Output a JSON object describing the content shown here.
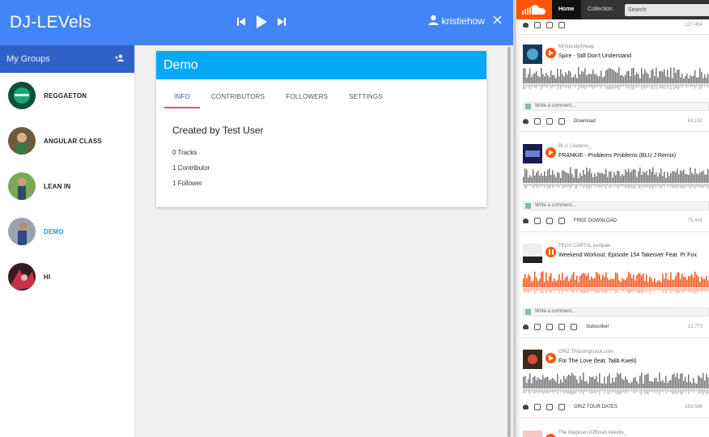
{
  "app": {
    "title": "DJ-LEVels",
    "user_name": "kristiehow"
  },
  "sidebar": {
    "heading": "My Groups",
    "groups": [
      {
        "label": "REGGAETON"
      },
      {
        "label": "ANGULAR CLASS"
      },
      {
        "label": "LEAN IN"
      },
      {
        "label": "DEMO"
      },
      {
        "label": "HI"
      }
    ]
  },
  "group": {
    "name": "Demo",
    "tabs": [
      "INFO",
      "CONTRIBUTORS",
      "FOLLOWERS",
      "SETTINGS"
    ],
    "active_tab": "INFO",
    "created_by": "Created by Test User",
    "tracks": "0 Tracks",
    "contributors": "1 Contributor",
    "followers": "1 Follower"
  },
  "soundcloud": {
    "nav": {
      "home": "Home",
      "collection": "Collection",
      "search_placeholder": "Search"
    },
    "comment_placeholder": "Write a comment...",
    "top_count": "127,454",
    "tracks": [
      {
        "uploader": "MrSuicideSheep",
        "title": "Spire - Still Don't Understand",
        "label": "Download",
        "count": "63,150"
      },
      {
        "uploader": "BLU J",
        "reposted_by": "kelenlu_",
        "title": "FRANKIE - Problems Problems (BLU J Remix)",
        "label": "FREE DOWNLOAD",
        "count": "75,446"
      },
      {
        "uploader": "FELIX CARTAL",
        "reposted_by": "portpaw",
        "title": "Weekend Workout: Episode 154 Takeover Feat. Pr Fox",
        "label": "Subscribe!",
        "count": "13,773"
      },
      {
        "uploader": "GRiZ",
        "reposted_by": "Thissongissick.com",
        "title": "For The Love (feat. Talib Kweli)",
        "label": "GRIZ TOUR DATES",
        "count": "263,586"
      },
      {
        "uploader": "The Magician (Official)",
        "reposted_by": "kelenlu_",
        "title": ""
      }
    ]
  },
  "colors": {
    "primary": "#4285f4",
    "sidebar_header": "#2f61c7",
    "card_header": "#03a9f4",
    "active_group": "#2196f3",
    "tab_underline": "#ec4b7b",
    "soundcloud_orange": "#ff5500"
  }
}
